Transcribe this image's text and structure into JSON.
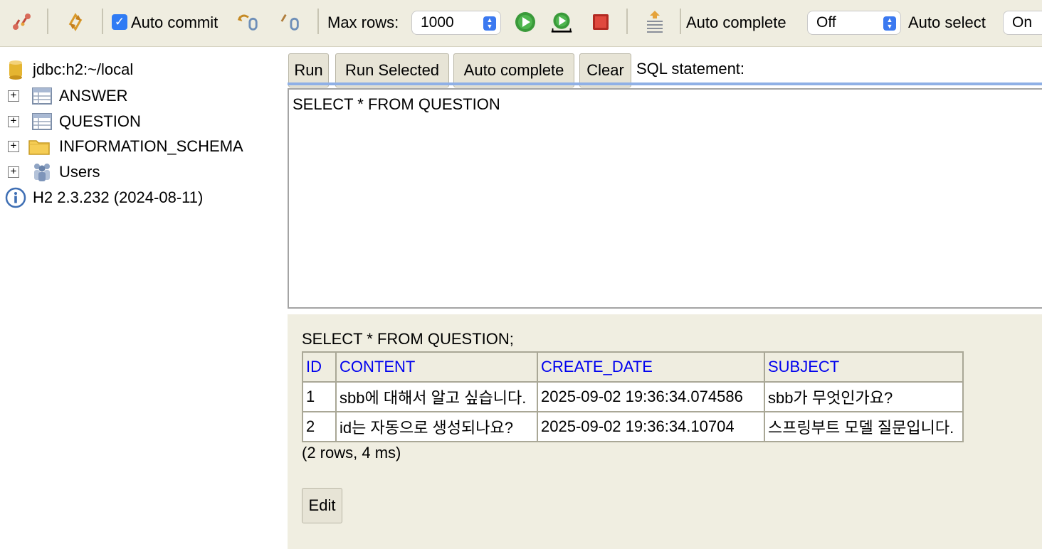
{
  "toolbar": {
    "icons": {
      "disconnect": "disconnect-icon",
      "refresh": "refresh-icon",
      "rollback": "rollback-icon",
      "commit": "commit-icon",
      "run": "run-icon",
      "run_selected": "run-selected-icon",
      "stop": "stop-icon",
      "history": "history-icon"
    },
    "auto_commit_label": "Auto commit",
    "auto_commit_checked": true,
    "max_rows_label": "Max rows:",
    "max_rows_value": "1000",
    "auto_complete_label": "Auto complete",
    "auto_complete_value": "Off",
    "auto_select_label": "Auto select",
    "auto_select_value": "On"
  },
  "tree": {
    "connection": "jdbc:h2:~/local",
    "items": [
      {
        "label": "ANSWER",
        "icon": "table-icon"
      },
      {
        "label": "QUESTION",
        "icon": "table-icon"
      },
      {
        "label": "INFORMATION_SCHEMA",
        "icon": "folder-icon"
      },
      {
        "label": "Users",
        "icon": "users-icon"
      }
    ],
    "version": "H2 2.3.232 (2024-08-11)"
  },
  "query": {
    "buttons": {
      "run": "Run",
      "run_selected": "Run Selected",
      "auto_complete": "Auto complete",
      "clear": "Clear"
    },
    "sql_label": "SQL statement:",
    "sql_text": "SELECT * FROM QUESTION"
  },
  "result": {
    "statement": "SELECT * FROM QUESTION;",
    "columns": [
      "ID",
      "CONTENT",
      "CREATE_DATE",
      "SUBJECT"
    ],
    "rows": [
      [
        "1",
        "sbb에 대해서 알고 싶습니다.",
        "2025-09-02 19:36:34.074586",
        "sbb가 무엇인가요?"
      ],
      [
        "2",
        "id는 자동으로 생성되나요?",
        "2025-09-02 19:36:34.10704",
        "스프링부트 모델 질문입니다."
      ]
    ],
    "info": "(2 rows, 4 ms)",
    "edit_label": "Edit"
  },
  "colors": {
    "toolbar_bg": "#efede0",
    "header_link": "#0000ee",
    "checkbox_accent": "#2f7bf4"
  }
}
